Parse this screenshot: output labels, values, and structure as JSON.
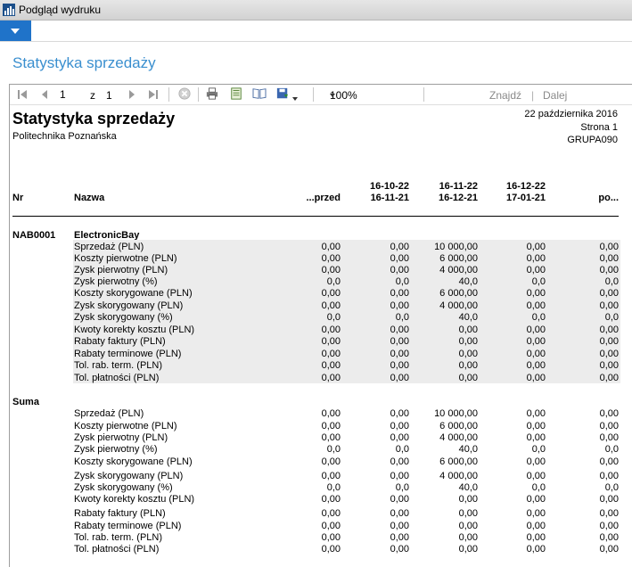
{
  "window": {
    "title": "Podgląd wydruku"
  },
  "page": {
    "heading": "Statystyka sprzedaży"
  },
  "toolbar": {
    "page_current": "1",
    "page_of_label": "z",
    "page_total": "1",
    "zoom": "100%",
    "find_label": "Znajdź",
    "separator": "|",
    "next_label": "Dalej"
  },
  "report": {
    "title": "Statystyka sprzedaży",
    "company": "Politechnika Poznańska",
    "date": "22 października 2016",
    "page_label": "Strona 1",
    "group_label": "GRUPA090",
    "columns": {
      "nr": "Nr",
      "name": "Nazwa",
      "c0": "...przed",
      "c1_a": "16-10-22",
      "c1_b": "16-11-21",
      "c2_a": "16-11-22",
      "c2_b": "16-12-21",
      "c3_a": "16-12-22",
      "c3_b": "17-01-21",
      "c4": "po..."
    },
    "group": {
      "id": "NAB0001",
      "name": "ElectronicBay",
      "rows": [
        {
          "label": "Sprzedaż (PLN)",
          "values": [
            "0,00",
            "0,00",
            "10 000,00",
            "0,00",
            "0,00"
          ]
        },
        {
          "label": "Koszty pierwotne (PLN)",
          "values": [
            "0,00",
            "0,00",
            "6 000,00",
            "0,00",
            "0,00"
          ]
        },
        {
          "label": "Zysk pierwotny (PLN)",
          "values": [
            "0,00",
            "0,00",
            "4 000,00",
            "0,00",
            "0,00"
          ]
        },
        {
          "label": "Zysk pierwotny (%)",
          "values": [
            "0,0",
            "0,0",
            "40,0",
            "0,0",
            "0,0"
          ]
        },
        {
          "label": "Koszty skorygowane (PLN)",
          "values": [
            "0,00",
            "0,00",
            "6 000,00",
            "0,00",
            "0,00"
          ]
        },
        {
          "label": "Zysk skorygowany (PLN)",
          "values": [
            "0,00",
            "0,00",
            "4 000,00",
            "0,00",
            "0,00"
          ]
        },
        {
          "label": "Zysk skorygowany (%)",
          "values": [
            "0,0",
            "0,0",
            "40,0",
            "0,0",
            "0,0"
          ]
        },
        {
          "label": "Kwoty korekty kosztu (PLN)",
          "values": [
            "0,00",
            "0,00",
            "0,00",
            "0,00",
            "0,00"
          ]
        },
        {
          "label": "Rabaty faktury (PLN)",
          "values": [
            "0,00",
            "0,00",
            "0,00",
            "0,00",
            "0,00"
          ]
        },
        {
          "label": "Rabaty terminowe (PLN)",
          "values": [
            "0,00",
            "0,00",
            "0,00",
            "0,00",
            "0,00"
          ]
        },
        {
          "label": "Tol. rab. term. (PLN)",
          "values": [
            "0,00",
            "0,00",
            "0,00",
            "0,00",
            "0,00"
          ]
        },
        {
          "label": "Tol. płatności (PLN)",
          "values": [
            "0,00",
            "0,00",
            "0,00",
            "0,00",
            "0,00"
          ]
        }
      ]
    },
    "total": {
      "label": "Suma",
      "rows": [
        {
          "label": "Sprzedaż (PLN)",
          "values": [
            "0,00",
            "0,00",
            "10 000,00",
            "0,00",
            "0,00"
          ]
        },
        {
          "label": "Koszty pierwotne (PLN)",
          "values": [
            "0,00",
            "0,00",
            "6 000,00",
            "0,00",
            "0,00"
          ]
        },
        {
          "label": "Zysk pierwotny (PLN)",
          "values": [
            "0,00",
            "0,00",
            "4 000,00",
            "0,00",
            "0,00"
          ]
        },
        {
          "label": "Zysk pierwotny (%)",
          "values": [
            "0,0",
            "0,0",
            "40,0",
            "0,0",
            "0,0"
          ]
        },
        {
          "label": "Koszty skorygowane (PLN)",
          "values": [
            "0,00",
            "0,00",
            "6 000,00",
            "0,00",
            "0,00"
          ]
        },
        {
          "label": "Zysk skorygowany (PLN)",
          "values": [
            "0,00",
            "0,00",
            "4 000,00",
            "0,00",
            "0,00"
          ]
        },
        {
          "label": "Zysk skorygowany (%)",
          "values": [
            "0,0",
            "0,0",
            "40,0",
            "0,0",
            "0,0"
          ]
        },
        {
          "label": "Kwoty korekty kosztu (PLN)",
          "values": [
            "0,00",
            "0,00",
            "0,00",
            "0,00",
            "0,00"
          ]
        },
        {
          "label": "Rabaty faktury (PLN)",
          "values": [
            "0,00",
            "0,00",
            "0,00",
            "0,00",
            "0,00"
          ]
        },
        {
          "label": "Rabaty terminowe (PLN)",
          "values": [
            "0,00",
            "0,00",
            "0,00",
            "0,00",
            "0,00"
          ]
        },
        {
          "label": "Tol. rab. term. (PLN)",
          "values": [
            "0,00",
            "0,00",
            "0,00",
            "0,00",
            "0,00"
          ]
        },
        {
          "label": "Tol. płatności (PLN)",
          "values": [
            "0,00",
            "0,00",
            "0,00",
            "0,00",
            "0,00"
          ]
        }
      ]
    }
  }
}
